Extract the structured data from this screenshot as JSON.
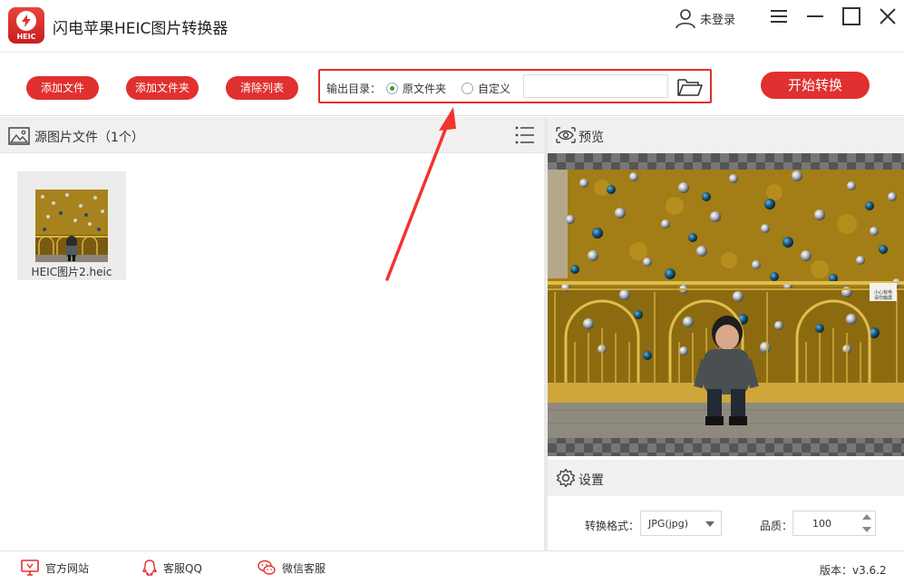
{
  "app": {
    "title": "闪电苹果HEIC图片转换器",
    "logo_text": "HEIC",
    "user_status": "未登录",
    "brand_color": "#e0302f"
  },
  "toolbar": {
    "add_file": "添加文件",
    "add_folder": "添加文件夹",
    "clear_list": "清除列表",
    "output_label": "输出目录：",
    "radio_original": "原文件夹",
    "radio_custom": "自定义",
    "selected_output": "原文件夹",
    "custom_path": "",
    "start": "开始转换"
  },
  "left_panel": {
    "title": "源图片文件（1个）",
    "files": [
      {
        "name": "HEIC图片2.heic"
      }
    ]
  },
  "right_panel": {
    "preview_title": "预览",
    "settings_title": "设置",
    "format_label": "转换格式：",
    "format_value": "JPG(jpg)",
    "quality_label": "品质：",
    "quality_value": "100"
  },
  "status_bar": {
    "website": "官方网站",
    "qq": "客服QQ",
    "wechat": "微信客服",
    "version": "版本：v3.6.2"
  },
  "icons": [
    "heic-logo-icon",
    "user-icon",
    "hamburger-menu-icon",
    "minimize-icon",
    "maximize-icon",
    "close-icon",
    "folder-open-icon",
    "image-icon",
    "list-icon",
    "eye-icon",
    "gear-icon",
    "monitor-icon",
    "qq-icon",
    "wechat-icon"
  ]
}
